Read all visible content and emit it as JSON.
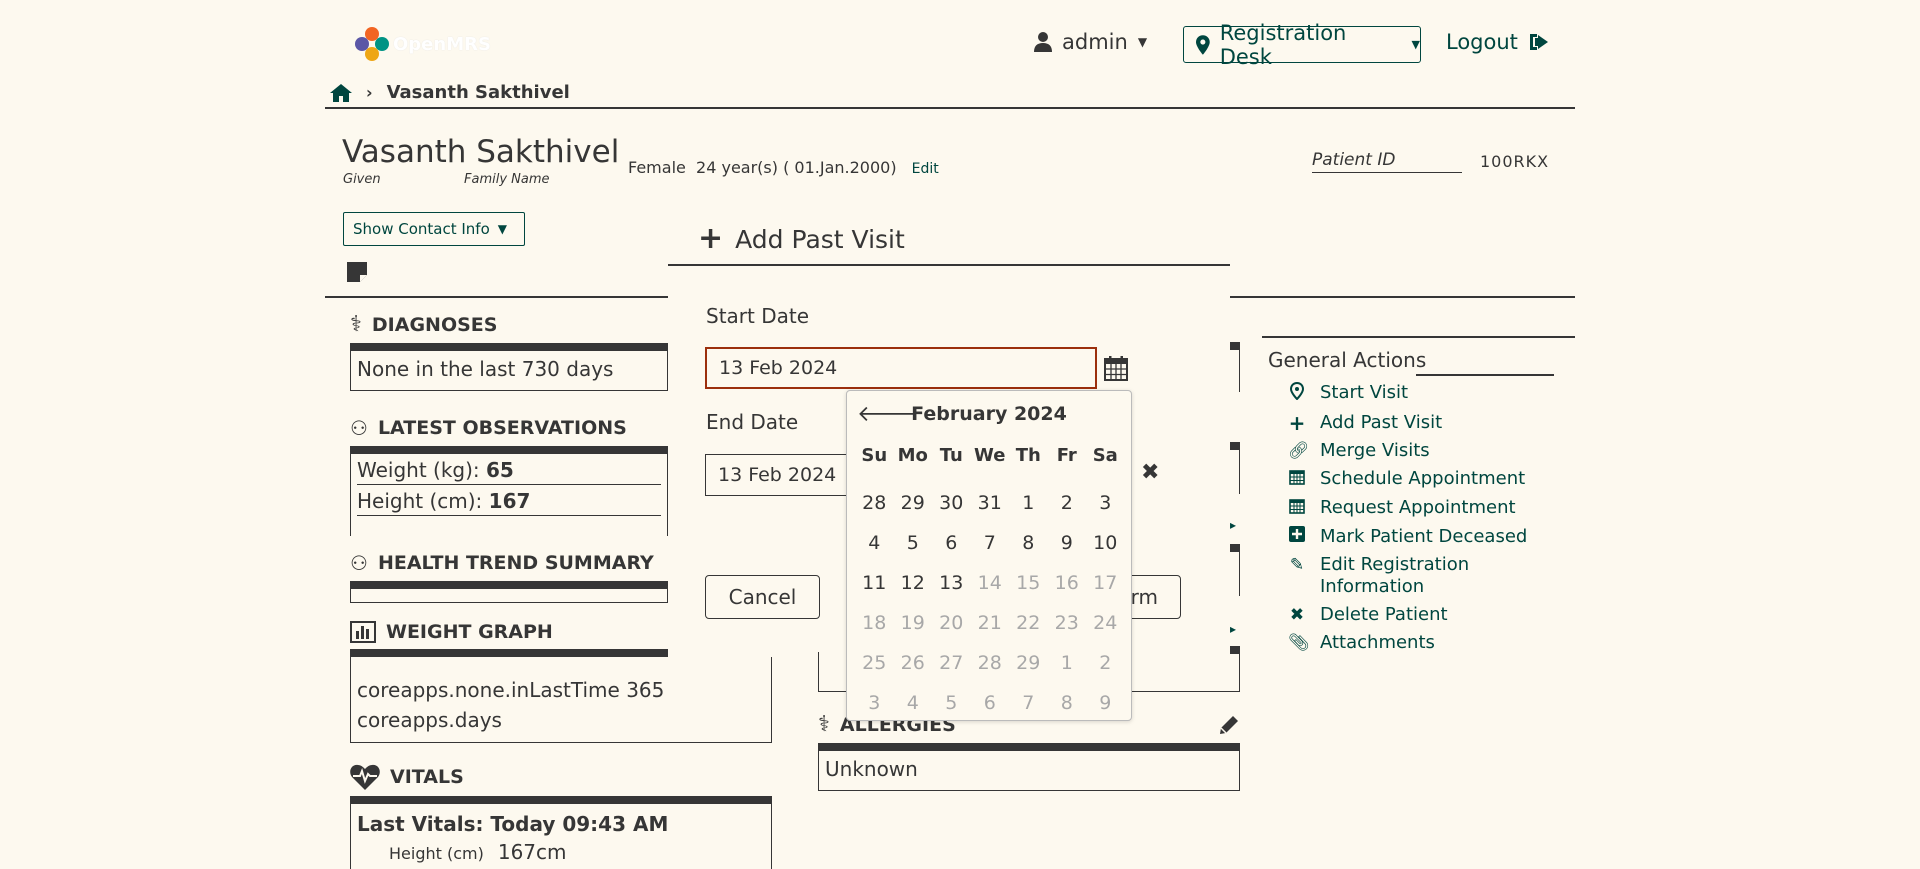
{
  "header": {
    "logo_text": "OpenMRS",
    "user": "admin",
    "location": "Registration Desk",
    "logout": "Logout"
  },
  "breadcrumb": {
    "patient": "Vasanth Sakthivel"
  },
  "patient": {
    "name": "Vasanth Sakthivel",
    "given_label": "Given",
    "family_label": "Family Name",
    "gender": "Female",
    "age": "24 year(s) ( 01.Jan.2000)",
    "edit": "Edit",
    "id_label": "Patient ID",
    "id_value": "100RKX",
    "show_contact": "Show Contact Info"
  },
  "widgets": {
    "diagnoses": {
      "title": "DIAGNOSES",
      "content": "None in the last 730 days"
    },
    "observations": {
      "title": "LATEST OBSERVATIONS",
      "rows": [
        {
          "label": "Weight (kg):",
          "value": "65"
        },
        {
          "label": "Height (cm):",
          "value": "167"
        }
      ]
    },
    "health_trend": {
      "title": "HEALTH TREND SUMMARY"
    },
    "weight_graph": {
      "title": "WEIGHT GRAPH",
      "line1": "coreapps.none.inLastTime 365",
      "line2": "coreapps.days"
    },
    "vitals": {
      "title": "VITALS",
      "last": "Last Vitals: Today 09:43 AM",
      "height_label": "Height (cm)",
      "height_value": "167cm"
    },
    "allergies": {
      "title": "ALLERGIES",
      "content": "Unknown"
    }
  },
  "general_actions": {
    "title": "General Actions",
    "items": [
      {
        "icon": "location-pin-icon",
        "label": "Start Visit"
      },
      {
        "icon": "plus-icon",
        "label": "Add Past Visit"
      },
      {
        "icon": "link-icon",
        "label": "Merge Visits"
      },
      {
        "icon": "calendar-icon",
        "label": "Schedule Appointment"
      },
      {
        "icon": "calendar-icon",
        "label": "Request Appointment"
      },
      {
        "icon": "plus-square-icon",
        "label": "Mark Patient Deceased"
      },
      {
        "icon": "pencil-icon",
        "label": "Edit Registration Information"
      },
      {
        "icon": "x-icon",
        "label": "Delete Patient"
      },
      {
        "icon": "paperclip-icon",
        "label": "Attachments"
      }
    ]
  },
  "modal": {
    "title": "Add Past Visit",
    "start_label": "Start Date",
    "start_value": "13 Feb 2024",
    "end_label": "End Date",
    "end_value": "13 Feb 2024",
    "cancel": "Cancel",
    "confirm_partial": "rm"
  },
  "datepicker": {
    "month": "February 2024",
    "days_of_week": [
      "Su",
      "Mo",
      "Tu",
      "We",
      "Th",
      "Fr",
      "Sa"
    ],
    "weeks": [
      [
        "28",
        "29",
        "30",
        "31",
        "1",
        "2",
        "3"
      ],
      [
        "4",
        "5",
        "6",
        "7",
        "8",
        "9",
        "10"
      ],
      [
        "11",
        "12",
        "13",
        "14",
        "15",
        "16",
        "17"
      ],
      [
        "18",
        "19",
        "20",
        "21",
        "22",
        "23",
        "24"
      ],
      [
        "25",
        "26",
        "27",
        "28",
        "29",
        "1",
        "2"
      ],
      [
        "3",
        "4",
        "5",
        "6",
        "7",
        "8",
        "9"
      ]
    ],
    "muted_from_index": 17
  }
}
